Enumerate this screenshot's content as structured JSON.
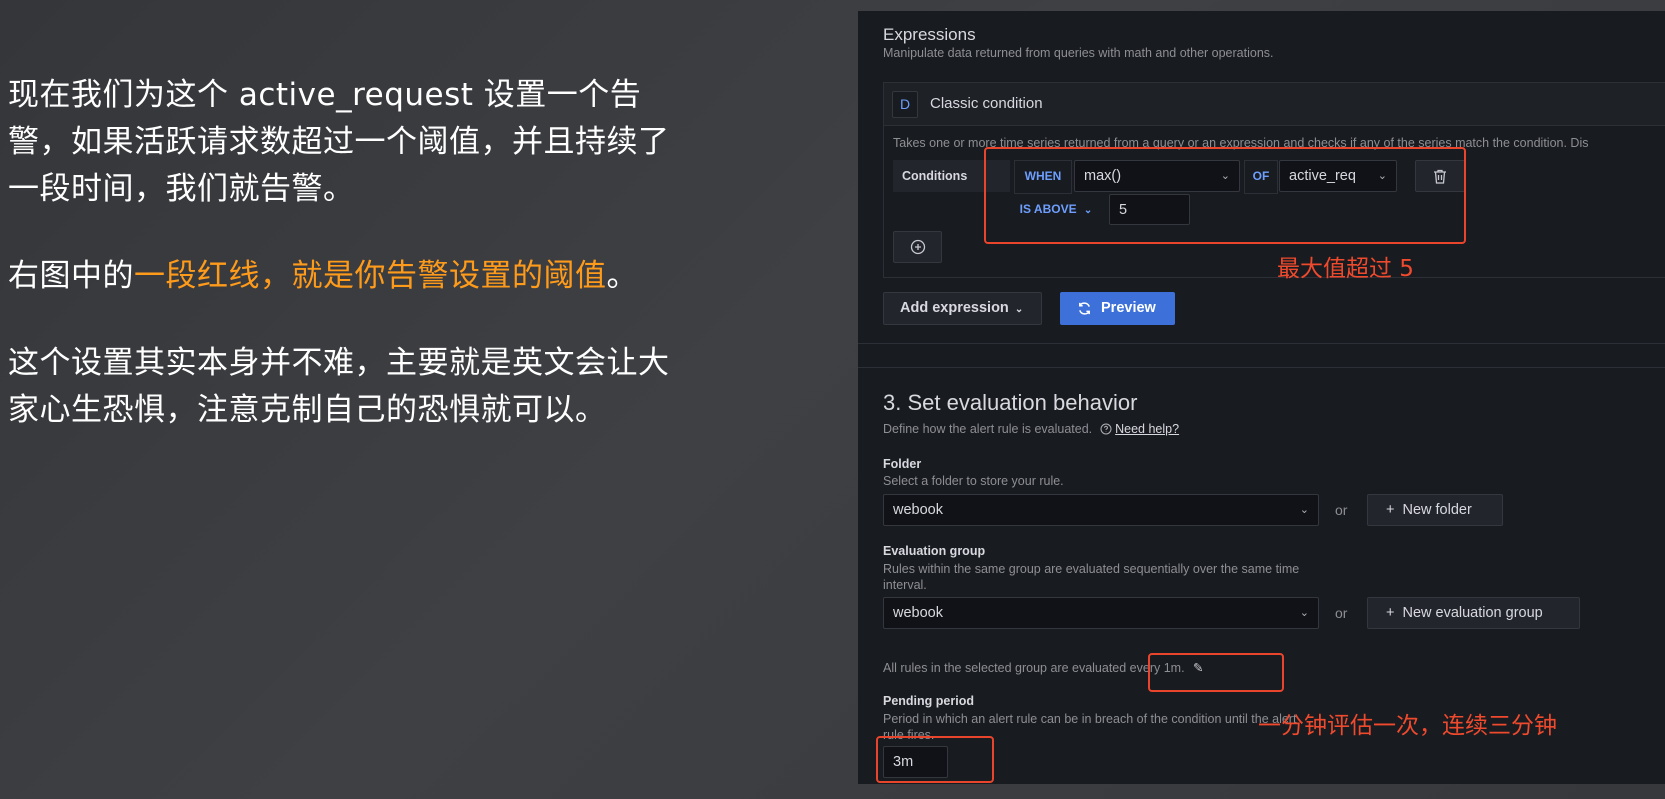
{
  "narration": {
    "para1": "现在我们为这个 active_request 设置一个告警，如果活跃请求数超过一个阈值，并且持续了一段时间，我们就告警。",
    "para2_before": "右图中的",
    "para2_highlight": "一段红线，就是你告警设置的阈值",
    "para2_after": "。",
    "para3": "这个设置其实本身并不难，主要就是英文会让大家心生恐惧，注意克制自己的恐惧就可以。"
  },
  "expressions": {
    "title": "Expressions",
    "subtitle": "Manipulate data returned from queries with math and other operations.",
    "card": {
      "ref_id": "D",
      "title": "Classic condition",
      "description": "Takes one or more time series returned from a query or an expression and checks if any of the series match the condition. Dis",
      "conditions_label": "Conditions",
      "when": "WHEN",
      "reducer": "max()",
      "of": "OF",
      "query": "active_req",
      "evaluator": "IS ABOVE",
      "threshold": "5"
    },
    "add_expression": "Add expression",
    "preview": "Preview"
  },
  "evaluation": {
    "title": "3. Set evaluation behavior",
    "subtitle": "Define how the alert rule is evaluated.",
    "help": "Need help?",
    "folder_label": "Folder",
    "folder_desc": "Select a folder to store your rule.",
    "folder_value": "webook",
    "or": "or",
    "new_folder": "New folder",
    "group_label": "Evaluation group",
    "group_desc": "Rules within the same group are evaluated sequentially over the same time interval.",
    "group_value": "webook",
    "new_group": "New evaluation group",
    "interval_text": "All rules in the selected group are evaluated every 1m.",
    "pending_label": "Pending period",
    "pending_desc": "Period in which an alert rule can be in breach of the condition until the alert rule fires.",
    "pending_value": "3m"
  },
  "annotations": {
    "threshold_note": "最大值超过 5",
    "interval_note": "一分钟评估一次，连续三分钟"
  },
  "colors": {
    "highlight": "#ff9b1a",
    "annotation_red": "#f04a2e",
    "primary_button": "#3d71d9"
  }
}
